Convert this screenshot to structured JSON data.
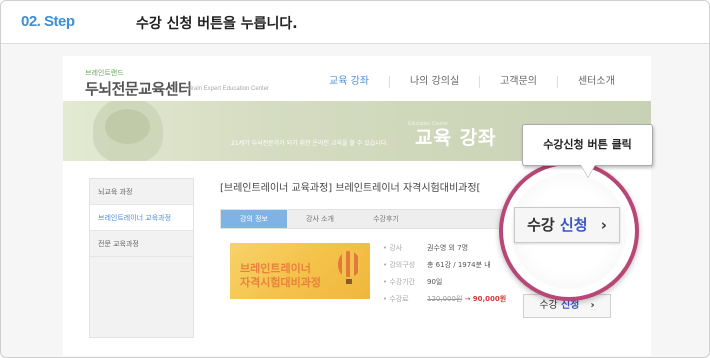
{
  "step": {
    "number": "02. Step",
    "instruction": "수강 신청 버튼을 누릅니다."
  },
  "site": {
    "logo_small": "브레인트랜드",
    "logo_main": "두뇌전문교육센터",
    "logo_sub": "Brain Expert Education Center"
  },
  "gnb": [
    {
      "label": "교육 강좌",
      "active": true
    },
    {
      "label": "나의 강의실",
      "active": false
    },
    {
      "label": "고객문의",
      "active": false
    },
    {
      "label": "센터소개",
      "active": false
    }
  ],
  "banner": {
    "tagline": "21세기 두뇌전문가가 되기 위한 온라인 교육을 할 수 있습니다.",
    "title_en": "Education Course",
    "title": "교육 강좌"
  },
  "lnb": [
    {
      "label": "뇌교육 과정",
      "active": false
    },
    {
      "label": "브레인트레이너 교육과정",
      "active": true
    },
    {
      "label": "전문 교육과정",
      "active": false
    }
  ],
  "course_title": "[브레인트레이너 교육과정] 브레인트레이너 자격시험대비과정[",
  "tabs": [
    {
      "label": "강의 정보",
      "active": true
    },
    {
      "label": "강사 소개",
      "active": false
    },
    {
      "label": "수강후기",
      "active": false
    }
  ],
  "thumbnail": {
    "line1": "브레인트레이너",
    "line2": "자격시험대비과정"
  },
  "info": {
    "instructor": {
      "label": "• 강사",
      "value": "권수영 외 7명"
    },
    "composition": {
      "label": "• 강의구성",
      "value": "총 61강 / 1974분 내"
    },
    "period": {
      "label": "• 수강기간",
      "value": "90일"
    },
    "fee": {
      "label": "• 수강료",
      "old": "120,000원",
      "arrow": "→",
      "new": "90,000원"
    }
  },
  "enroll_button": {
    "prefix": "수강",
    "highlight": "신청",
    "chevron": "›"
  },
  "callout": "수강신청 버튼 클릭",
  "colors": {
    "accent": "#3d8fd6",
    "highlight_ring": "#b84777",
    "button_blue": "#3b55c7",
    "price_red": "#d23b3b"
  }
}
